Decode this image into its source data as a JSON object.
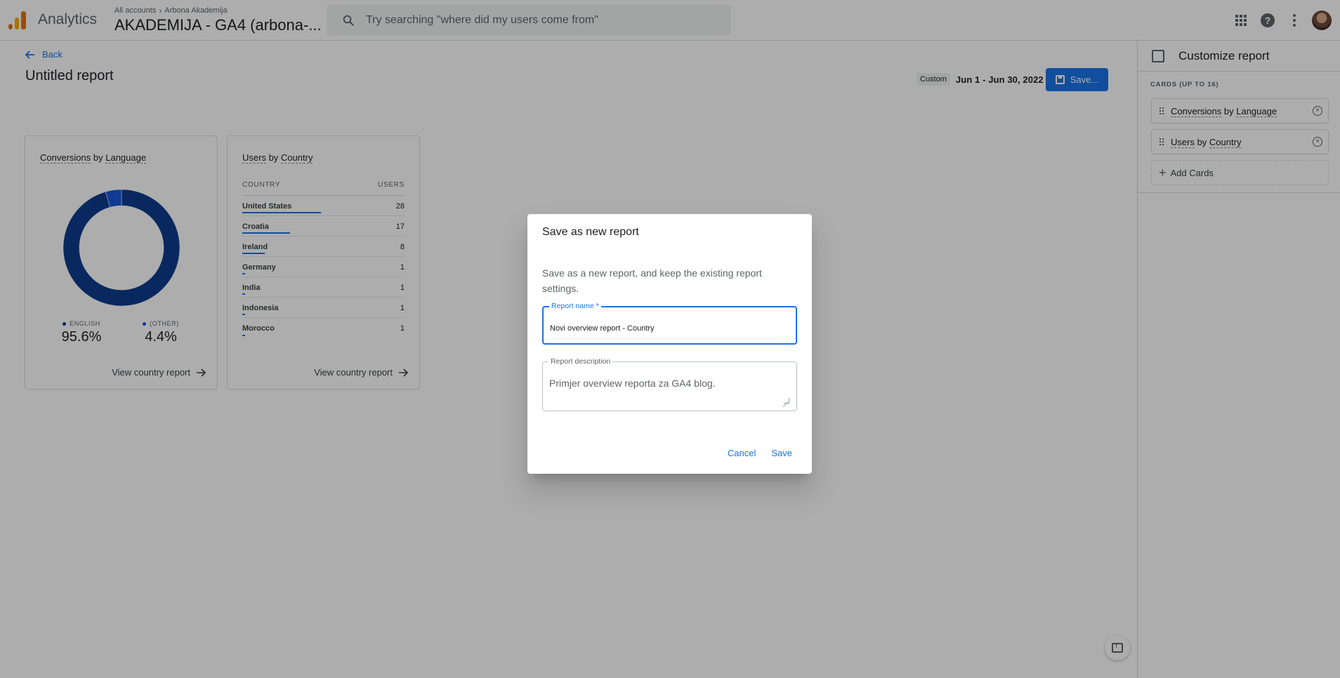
{
  "header": {
    "app_name": "Analytics",
    "breadcrumb": {
      "account": "All accounts",
      "property_group": "Arbona Akademija"
    },
    "property_name": "AKADEMIJA - GA4 (arbona-...",
    "search_placeholder": "Try searching \"where did my users come from\""
  },
  "main": {
    "back_label": "Back",
    "title": "Untitled report",
    "date_badge": "Custom",
    "date_range": "Jun 1 - Jun 30, 2022",
    "save_label": "Save..."
  },
  "cards": {
    "language": {
      "title_part1": "Conversions",
      "title_mid": " by ",
      "title_part2": "Language",
      "chart_data": {
        "type": "pie",
        "categories": [
          "ENGLISH",
          "(OTHER)"
        ],
        "values": [
          95.6,
          4.4
        ],
        "colors": [
          "#0d3b8c",
          "#1a56db"
        ]
      },
      "legend": [
        {
          "label": "ENGLISH",
          "value": "95.6%",
          "color": "#0d3b8c"
        },
        {
          "label": "(OTHER)",
          "value": "4.4%",
          "color": "#1a56db"
        }
      ],
      "link": "View country report"
    },
    "country": {
      "title_part1": "Users",
      "title_mid": " by ",
      "title_part2": "Country",
      "columns": [
        "COUNTRY",
        "USERS"
      ],
      "rows": [
        {
          "country": "United States",
          "users": "28",
          "share": 1.0
        },
        {
          "country": "Croatia",
          "users": "17",
          "share": 0.607
        },
        {
          "country": "Ireland",
          "users": "8",
          "share": 0.286
        },
        {
          "country": "Germany",
          "users": "1",
          "share": 0.036
        },
        {
          "country": "India",
          "users": "1",
          "share": 0.036
        },
        {
          "country": "Indonesia",
          "users": "1",
          "share": 0.036
        },
        {
          "country": "Morocco",
          "users": "1",
          "share": 0.036
        }
      ],
      "link": "View country report"
    }
  },
  "panel": {
    "title": "Customize report",
    "cards_label": "CARDS (UP TO 16)",
    "cards": [
      {
        "part1": "Conversions",
        "mid": " by ",
        "part2": "Language"
      },
      {
        "part1": "Users",
        "mid": " by ",
        "part2": "Country"
      }
    ],
    "add_label": "Add Cards"
  },
  "dialog": {
    "title": "Save as new report",
    "text": "Save as a new report, and keep the existing report settings.",
    "name_label": "Report name *",
    "name_value": "Novi overview report - Country",
    "desc_label": "Report description",
    "desc_value": "Primjer overview reporta za GA4 blog.",
    "cancel": "Cancel",
    "save": "Save"
  }
}
